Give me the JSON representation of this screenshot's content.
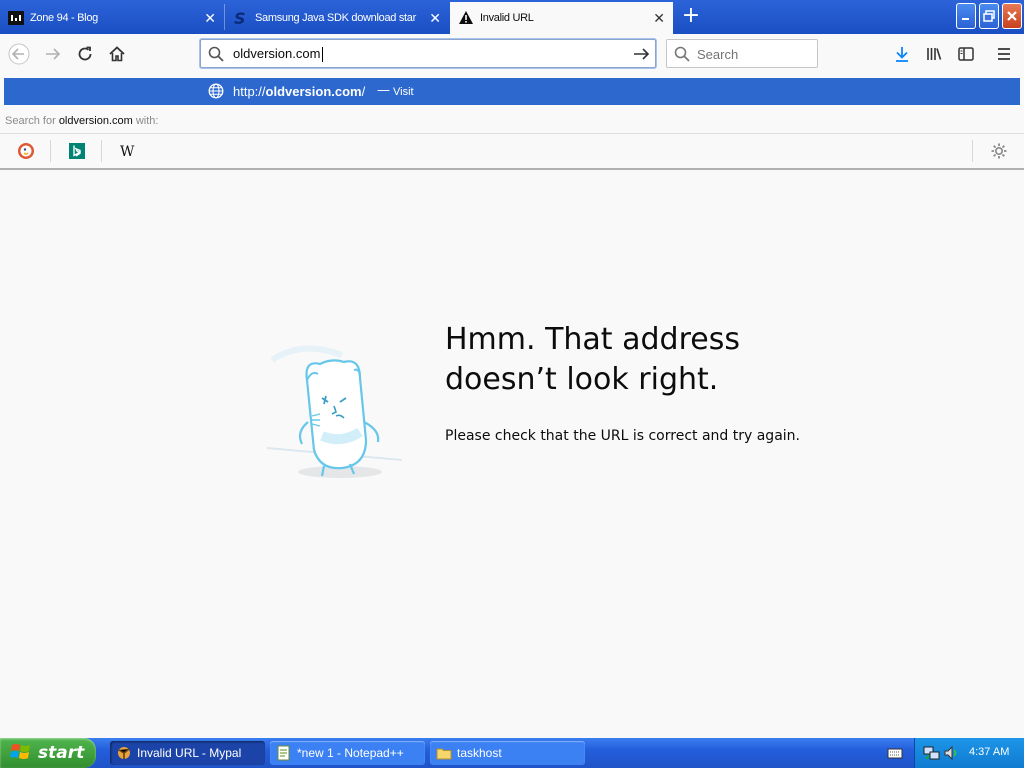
{
  "tabs": [
    {
      "title": "Zone 94 - Blog",
      "favicon": "zone94-icon",
      "active": false
    },
    {
      "title": "Samsung Java SDK download star",
      "favicon": "samsung-s-icon",
      "active": false
    },
    {
      "title": "Invalid URL",
      "favicon": "warning-icon",
      "active": true
    }
  ],
  "window_controls": {
    "minimize": "minimize-icon",
    "maximize": "restore-icon",
    "close": "close-icon"
  },
  "navbar": {
    "url_value": "oldversion.com",
    "search_placeholder": "Search"
  },
  "autocomplete": {
    "suggestion_prefix": "http://",
    "suggestion_host": "oldversion.com",
    "suggestion_suffix": "/",
    "dash": "—",
    "action": "Visit",
    "search_for_label": "Search for",
    "search_for_term": "oldversion.com",
    "search_for_with": "with:",
    "engines": [
      "DuckDuckGo",
      "Bing",
      "Wikipedia"
    ]
  },
  "error": {
    "title_line1": "Hmm. That address",
    "title_line2": "doesn’t look right.",
    "message": "Please check that the URL is correct and try again."
  },
  "taskbar": {
    "start_label": "start",
    "items": [
      {
        "label": "Invalid URL - Mypal",
        "active": true
      },
      {
        "label": "*new 1 - Notepad++",
        "active": false
      },
      {
        "label": "taskhost",
        "active": false
      }
    ],
    "clock": "4:37 AM"
  },
  "colors": {
    "titlebar": "#1a4fc4",
    "selection": "#2d68cf",
    "page_bg": "#f9f9fa",
    "start_green": "#3c9b38"
  }
}
